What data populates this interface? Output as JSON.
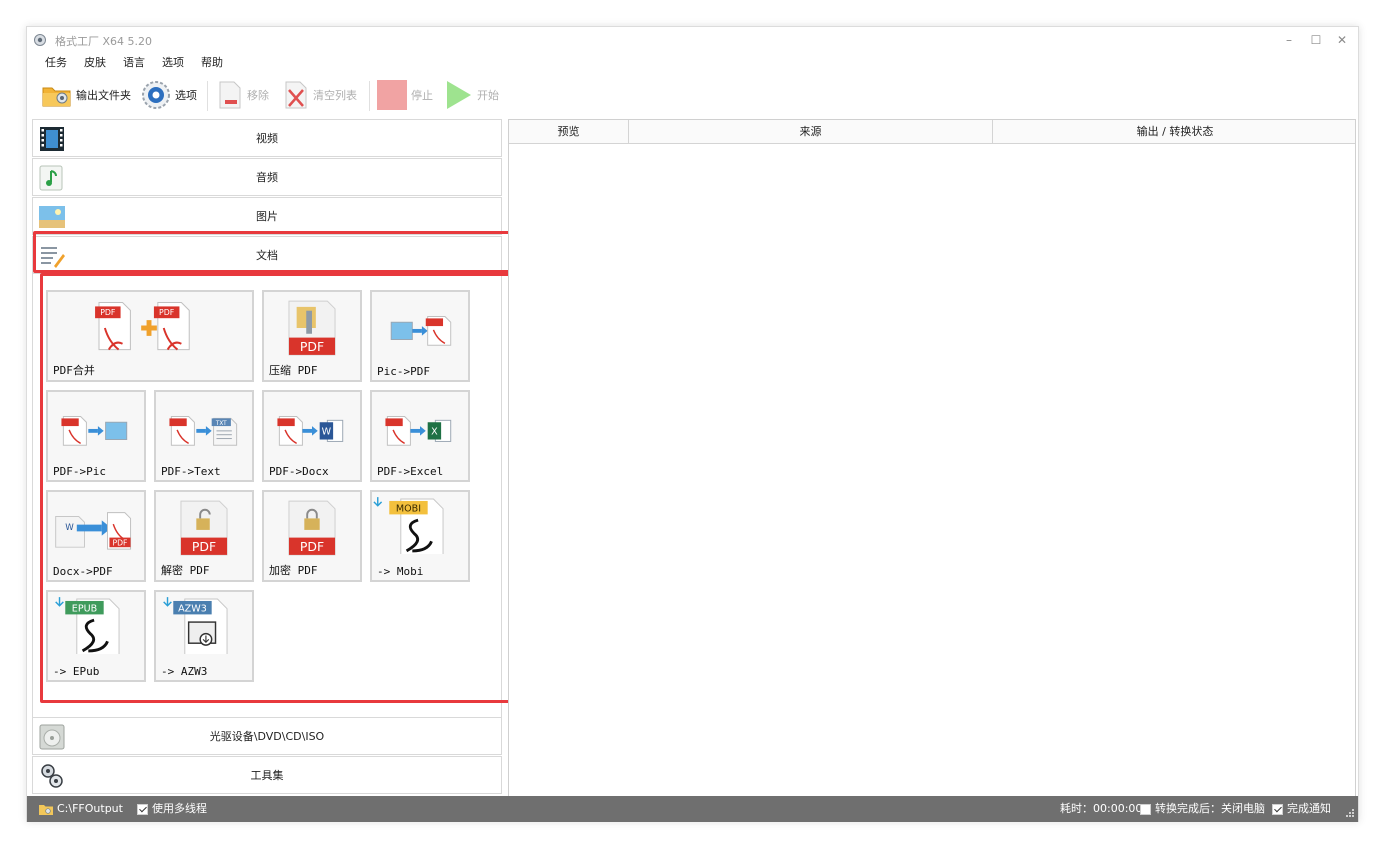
{
  "window": {
    "title": "格式工厂 X64 5.20",
    "minimize": "–",
    "maximize": "☐",
    "close": "✕"
  },
  "menu": [
    "任务",
    "皮肤",
    "语言",
    "选项",
    "帮助"
  ],
  "toolbar": {
    "output_folder": "输出文件夹",
    "options": "选项",
    "remove": "移除",
    "clear_list": "清空列表",
    "stop": "停止",
    "start": "开始"
  },
  "categories": {
    "video": "视频",
    "audio": "音频",
    "image": "图片",
    "document": "文档",
    "rom": "光驱设备\\DVD\\CD\\ISO",
    "tools": "工具集"
  },
  "doc_tools": [
    {
      "label": "PDF合并",
      "icon": "pdf-merge-icon"
    },
    {
      "label": "压缩 PDF",
      "icon": "pdf-compress-icon"
    },
    {
      "label": "Pic->PDF",
      "icon": "pic-to-pdf-icon"
    },
    {
      "label": "PDF->Pic",
      "icon": "pdf-to-pic-icon"
    },
    {
      "label": "PDF->Text",
      "icon": "pdf-to-text-icon"
    },
    {
      "label": "PDF->Docx",
      "icon": "pdf-to-docx-icon"
    },
    {
      "label": "PDF->Excel",
      "icon": "pdf-to-excel-icon"
    },
    {
      "label": "Docx->PDF",
      "icon": "docx-to-pdf-icon"
    },
    {
      "label": "解密 PDF",
      "icon": "pdf-decrypt-icon"
    },
    {
      "label": "加密 PDF",
      "icon": "pdf-encrypt-icon"
    },
    {
      "label": "-> Mobi",
      "icon": "to-mobi-icon"
    },
    {
      "label": "-> EPub",
      "icon": "to-epub-icon"
    },
    {
      "label": "-> AZW3",
      "icon": "to-azw3-icon"
    }
  ],
  "badges": {
    "pdf": "PDF",
    "txt": "TXT",
    "w": "W",
    "x": "X",
    "mobi": "MOBI",
    "epub": "EPUB",
    "azw3": "AZW3"
  },
  "list_columns": {
    "preview": "预览",
    "source": "来源",
    "status": "输出 / 转换状态"
  },
  "status": {
    "output_path": "C:\\FFOutput",
    "multithread": "使用多线程",
    "elapsed": "耗时：00:00:00",
    "after_convert": "转换完成后：关闭电脑",
    "notify": "完成通知"
  },
  "colors": {
    "highlight": "#e8393d",
    "pdf_red": "#d9342b",
    "statusbar": "#6f6f6f"
  }
}
